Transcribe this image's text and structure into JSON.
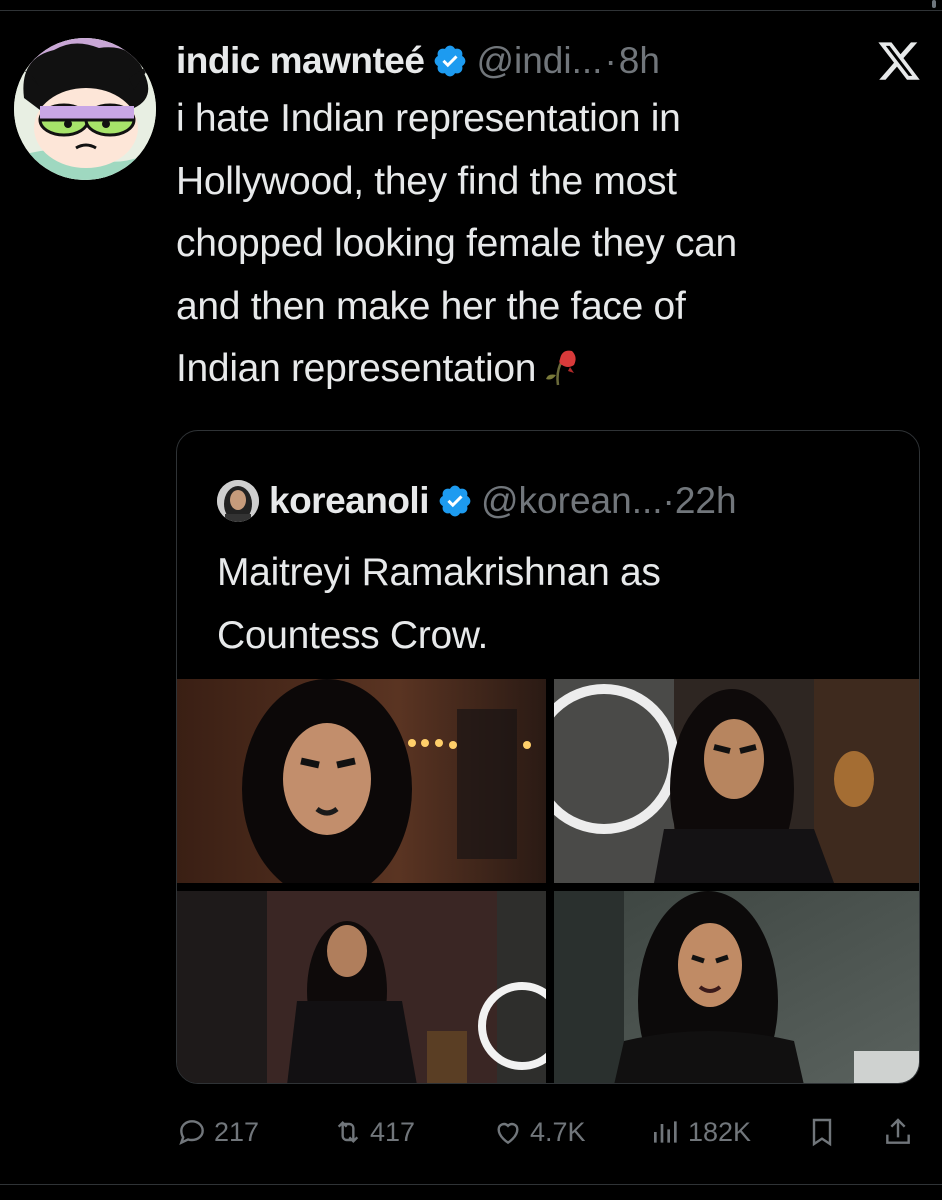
{
  "tweet": {
    "display_name": "indic mawnteé",
    "handle": "@indi...",
    "separator": "·",
    "time": "8h",
    "text_lines": [
      "i hate Indian representation in",
      "Hollywood, they find the most",
      "chopped looking female they can",
      "and then make her the face of",
      "Indian representation"
    ],
    "emoji_icon": "wilted-rose-icon"
  },
  "quote": {
    "display_name": "koreanoli",
    "handle": "@korean...",
    "separator": "·",
    "time": "22h",
    "text_lines": [
      "Maitreyi Ramakrishnan as",
      "Countess Crow."
    ],
    "media_count": 4
  },
  "actions": {
    "replies": "217",
    "reposts": "417",
    "likes": "4.7K",
    "views": "182K"
  },
  "colors": {
    "background": "#000000",
    "text": "#e7e9ea",
    "muted": "#71767b",
    "verified": "#1d9bf0",
    "border": "#2f3336"
  }
}
